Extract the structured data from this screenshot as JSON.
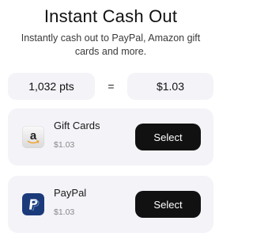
{
  "header": {
    "title": "Instant Cash Out",
    "subtitle": "Instantly cash out to PayPal, Amazon gift cards and more."
  },
  "conversion": {
    "points": "1,032 pts",
    "equals": "=",
    "amount": "$1.03"
  },
  "options": [
    {
      "name": "Gift Cards",
      "price": "$1.03",
      "button_label": "Select",
      "icon": "amazon-logo-icon"
    },
    {
      "name": "PayPal",
      "price": "$1.03",
      "button_label": "Select",
      "icon": "paypal-logo-icon"
    }
  ],
  "colors": {
    "card_background": "#f3f3f8",
    "button_background": "#111111",
    "button_text": "#ffffff",
    "paypal_blue": "#1b3a7a",
    "amazon_orange": "#f0a33a"
  }
}
